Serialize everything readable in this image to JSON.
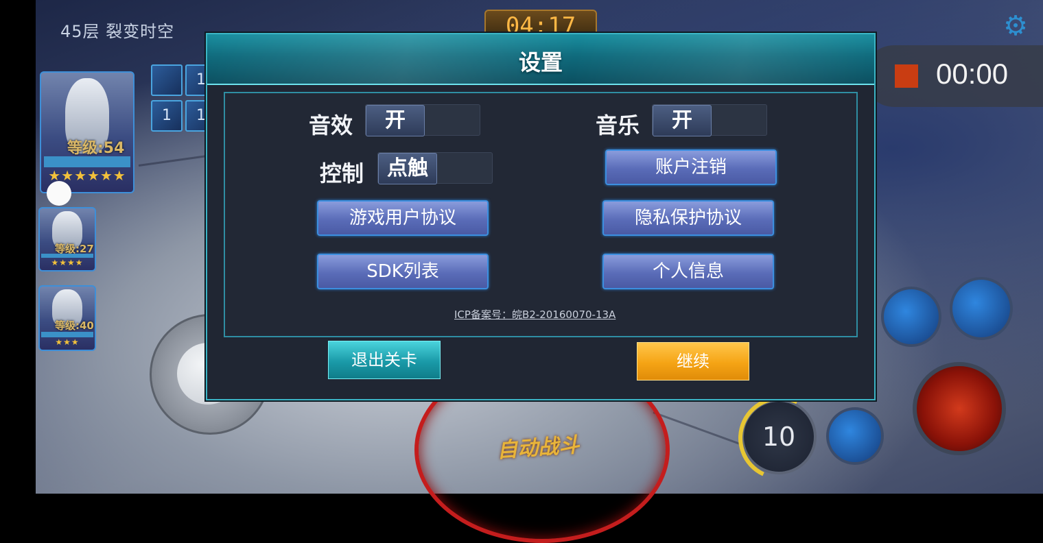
{
  "hud": {
    "floor_label": "45层  裂变时空",
    "timer": "04:17",
    "gear_icon": "gear-icon"
  },
  "recorder": {
    "time": "00:00"
  },
  "team": [
    {
      "level": "等级:54",
      "stars": "★★★★★★"
    },
    {
      "level": "等级:27",
      "stars": "★★★★"
    },
    {
      "level": "等级:40",
      "stars": "★★★"
    }
  ],
  "buff_icons": [
    "",
    "1",
    "1",
    "1"
  ],
  "skills": {
    "cooldown": "10",
    "auto_battle_label": "自动战斗"
  },
  "settings": {
    "title": "设置",
    "sound_label": "音效",
    "sound_value": "开",
    "music_label": "音乐",
    "music_value": "开",
    "control_label": "控制",
    "control_value": "点触",
    "account_cancel": "账户注销",
    "user_agreement": "游戏用户协议",
    "privacy_agreement": "隐私保护协议",
    "sdk_list": "SDK列表",
    "personal_info": "个人信息",
    "icp": "ICP备案号：皖B2-20160070-13A",
    "exit_button": "退出关卡",
    "continue_button": "继续"
  },
  "colors": {
    "dialog_accent": "#3bb5c6",
    "button_blue": "#5a6cb8",
    "continue_orange": "#f5a415",
    "exit_teal": "#1a9aa8"
  }
}
